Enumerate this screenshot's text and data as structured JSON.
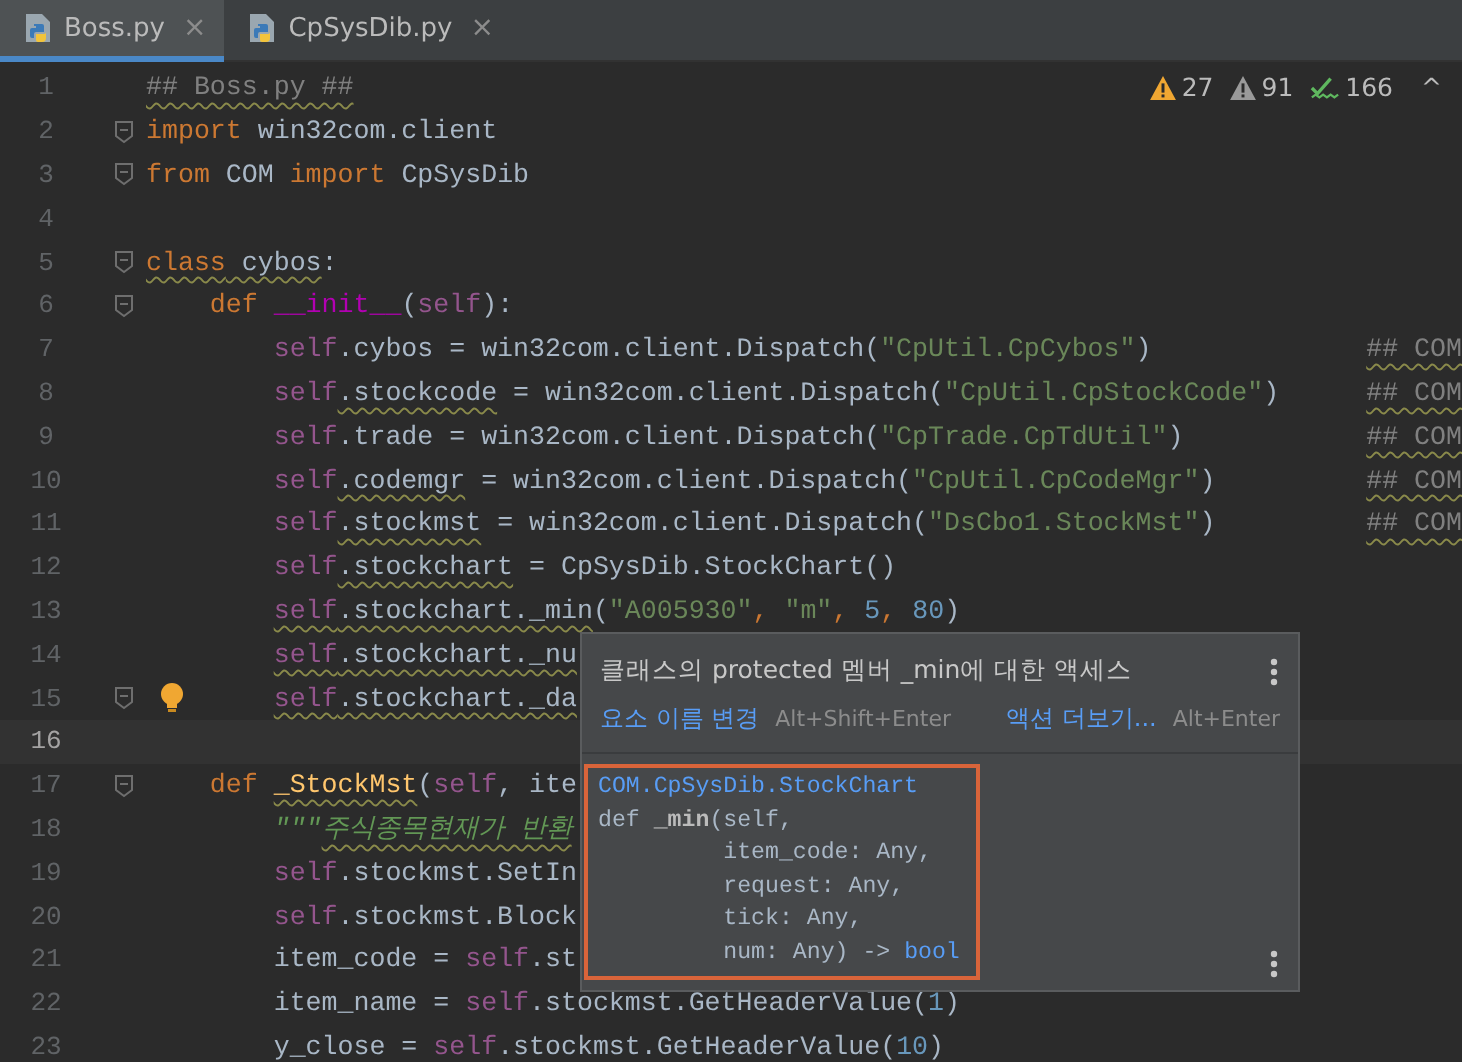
{
  "tabs": [
    {
      "label": "Boss.py",
      "selected": true,
      "close": "×"
    },
    {
      "label": "CpSysDib.py",
      "selected": false,
      "close": "×"
    }
  ],
  "inspections": [
    {
      "kind": "warning",
      "count": "27"
    },
    {
      "kind": "weak-warning",
      "count": "91"
    },
    {
      "kind": "typo",
      "count": "166"
    }
  ],
  "inspections_nav": "^",
  "lines": [
    {
      "number": "1",
      "current": false,
      "fold": false,
      "bulb": false,
      "tokens": [
        {
          "t": "## Boss.py ##",
          "kind": "cmt",
          "wavy": true
        }
      ]
    },
    {
      "number": "2",
      "current": false,
      "fold": true,
      "bulb": false,
      "tokens": [
        {
          "t": "import",
          "kind": "kw"
        },
        {
          "t": " win32com.client",
          "kind": "plain"
        }
      ]
    },
    {
      "number": "3",
      "current": false,
      "fold": true,
      "bulb": false,
      "tokens": [
        {
          "t": "from",
          "kind": "kw"
        },
        {
          "t": " COM ",
          "kind": "plain"
        },
        {
          "t": "import",
          "kind": "kw"
        },
        {
          "t": " CpSysDib",
          "kind": "plain"
        }
      ]
    },
    {
      "number": "4",
      "current": false,
      "fold": false,
      "bulb": false
    },
    {
      "number": "5",
      "current": false,
      "fold": true,
      "bulb": false,
      "tokens": [
        {
          "t": "class",
          "kind": "kw",
          "wavy": true
        },
        {
          "t": " cybos",
          "kind": "plain",
          "wavy": true
        },
        {
          "t": ":",
          "kind": "plain"
        }
      ]
    },
    {
      "number": "6",
      "current": false,
      "fold": true,
      "bulb": false,
      "tokens": [
        {
          "t": "    def ",
          "kind": "kw"
        },
        {
          "t": "__init__",
          "kind": "magic"
        },
        {
          "t": "(",
          "kind": "plain"
        },
        {
          "t": "self",
          "kind": "self"
        },
        {
          "t": "):",
          "kind": "plain"
        }
      ]
    },
    {
      "number": "7",
      "current": false,
      "fold": false,
      "bulb": false,
      "tokens": [
        {
          "t": "        self",
          "kind": "self"
        },
        {
          "t": ".cybos = win32com.client.Dispatch(",
          "kind": "plain"
        },
        {
          "t": "\"CpUtil.CpCybos\"",
          "kind": "str"
        },
        {
          "t": ")",
          "kind": "plain"
        }
      ],
      "comment": "## COM"
    },
    {
      "number": "8",
      "current": false,
      "fold": false,
      "bulb": false,
      "tokens": [
        {
          "t": "        self",
          "kind": "self"
        },
        {
          "t": ".stockcode",
          "kind": "plain",
          "wavy": true
        },
        {
          "t": " = win32com.client.Dispatch(",
          "kind": "plain"
        },
        {
          "t": "\"CpUtil.CpStockCode\"",
          "kind": "str"
        },
        {
          "t": ")",
          "kind": "plain"
        }
      ],
      "comment": "## COM"
    },
    {
      "number": "9",
      "current": false,
      "fold": false,
      "bulb": false,
      "tokens": [
        {
          "t": "        self",
          "kind": "self"
        },
        {
          "t": ".trade = win32com.client.Dispatch(",
          "kind": "plain"
        },
        {
          "t": "\"CpTrade.CpTdUtil\"",
          "kind": "str"
        },
        {
          "t": ")",
          "kind": "plain"
        }
      ],
      "comment": "## COM"
    },
    {
      "number": "10",
      "current": false,
      "fold": false,
      "bulb": false,
      "tokens": [
        {
          "t": "        self",
          "kind": "self"
        },
        {
          "t": ".codemgr",
          "kind": "plain",
          "wavy": true
        },
        {
          "t": " = win32com.client.Dispatch(",
          "kind": "plain"
        },
        {
          "t": "\"CpUtil.CpCodeMgr\"",
          "kind": "str"
        },
        {
          "t": ")",
          "kind": "plain"
        }
      ],
      "comment": "## COM"
    },
    {
      "number": "11",
      "current": false,
      "fold": false,
      "bulb": false,
      "tokens": [
        {
          "t": "        self",
          "kind": "self"
        },
        {
          "t": ".stockmst",
          "kind": "plain",
          "wavy": true
        },
        {
          "t": " = win32com.client.Dispatch(",
          "kind": "plain"
        },
        {
          "t": "\"DsCbo1.StockMst\"",
          "kind": "str"
        },
        {
          "t": ")",
          "kind": "plain"
        }
      ],
      "comment": "## COM"
    },
    {
      "number": "12",
      "current": false,
      "fold": false,
      "bulb": false,
      "tokens": [
        {
          "t": "        self",
          "kind": "self"
        },
        {
          "t": ".stockchart",
          "kind": "plain",
          "wavy": true
        },
        {
          "t": " = CpSysDib.StockChart()",
          "kind": "plain"
        }
      ]
    },
    {
      "number": "13",
      "current": false,
      "fold": false,
      "bulb": false,
      "tokens": [
        {
          "t": "        self",
          "kind": "self",
          "wavy": true
        },
        {
          "t": ".stockchart._min",
          "kind": "plain",
          "wavy": true
        },
        {
          "t": "(",
          "kind": "plain"
        },
        {
          "t": "\"A005930\"",
          "kind": "str"
        },
        {
          "t": ", ",
          "kind": "kw"
        },
        {
          "t": "\"m\"",
          "kind": "str"
        },
        {
          "t": ", ",
          "kind": "kw"
        },
        {
          "t": "5",
          "kind": "num"
        },
        {
          "t": ", ",
          "kind": "kw"
        },
        {
          "t": "80",
          "kind": "num"
        },
        {
          "t": ")",
          "kind": "plain"
        }
      ]
    },
    {
      "number": "14",
      "current": false,
      "fold": false,
      "bulb": false,
      "tokens": [
        {
          "t": "        self",
          "kind": "self",
          "wavy": true
        },
        {
          "t": ".stockchart._nu",
          "kind": "plain",
          "wavy": true
        }
      ]
    },
    {
      "number": "15",
      "current": false,
      "fold": true,
      "bulb": true,
      "tokens": [
        {
          "t": "        self",
          "kind": "self",
          "wavy": true
        },
        {
          "t": ".stockchart._da",
          "kind": "plain",
          "wavy": true
        }
      ]
    },
    {
      "number": "16",
      "current": true,
      "fold": false,
      "bulb": false
    },
    {
      "number": "17",
      "current": false,
      "fold": true,
      "bulb": false,
      "tokens": [
        {
          "t": "    def ",
          "kind": "kw"
        },
        {
          "t": "_StockMst",
          "kind": "fn",
          "wavy": true
        },
        {
          "t": "(",
          "kind": "plain"
        },
        {
          "t": "self",
          "kind": "self"
        },
        {
          "t": ", ite",
          "kind": "plain"
        }
      ]
    },
    {
      "number": "18",
      "current": false,
      "fold": false,
      "bulb": false,
      "tokens": [
        {
          "t": "        \"\"\"",
          "kind": "doc"
        },
        {
          "t": "주식종목현재가 반환",
          "kind": "doc",
          "wavy": true
        }
      ]
    },
    {
      "number": "19",
      "current": false,
      "fold": false,
      "bulb": false,
      "tokens": [
        {
          "t": "        self",
          "kind": "self"
        },
        {
          "t": ".stockmst.SetIn",
          "kind": "plain"
        }
      ]
    },
    {
      "number": "20",
      "current": false,
      "fold": false,
      "bulb": false,
      "tokens": [
        {
          "t": "        self",
          "kind": "self"
        },
        {
          "t": ".stockmst.Block",
          "kind": "plain"
        }
      ]
    },
    {
      "number": "21",
      "current": false,
      "fold": false,
      "bulb": false,
      "tokens": [
        {
          "t": "        item_code = ",
          "kind": "plain"
        },
        {
          "t": "self",
          "kind": "self"
        },
        {
          "t": ".st",
          "kind": "plain"
        }
      ]
    },
    {
      "number": "22",
      "current": false,
      "fold": false,
      "bulb": false,
      "tokens": [
        {
          "t": "        item_name = ",
          "kind": "plain"
        },
        {
          "t": "self",
          "kind": "self"
        },
        {
          "t": ".stockmst.GetHeaderValue(",
          "kind": "plain"
        },
        {
          "t": "1",
          "kind": "num"
        },
        {
          "t": ")",
          "kind": "plain"
        }
      ]
    },
    {
      "number": "23",
      "current": false,
      "fold": false,
      "bulb": false,
      "tokens": [
        {
          "t": "        y_close = ",
          "kind": "plain"
        },
        {
          "t": "self",
          "kind": "self"
        },
        {
          "t": ".stockmst.GetHeaderValue(",
          "kind": "plain"
        },
        {
          "t": "10",
          "kind": "num"
        },
        {
          "t": ")",
          "kind": "plain"
        }
      ]
    }
  ],
  "popup": {
    "title": "클래스의 protected 멤버 _min에 대한 액세스",
    "actions": [
      {
        "label": "요소 이름 변경",
        "shortcut": "Alt+Shift+Enter"
      },
      {
        "label": "액션 더보기...",
        "shortcut": "Alt+Enter"
      }
    ],
    "doc": [
      [
        {
          "t": "COM.CpSysDib.StockChart",
          "kind": "link"
        }
      ],
      [
        {
          "t": "def ",
          "kind": "plain"
        },
        {
          "t": "_min",
          "kind": "bold"
        },
        {
          "t": "(self,",
          "kind": "plain"
        }
      ],
      [
        {
          "t": "         item_code: Any,",
          "kind": "plain"
        }
      ],
      [
        {
          "t": "         request: Any,",
          "kind": "plain"
        }
      ],
      [
        {
          "t": "         tick: Any,",
          "kind": "plain"
        }
      ],
      [
        {
          "t": "         num: Any) -> ",
          "kind": "plain"
        },
        {
          "t": "bool",
          "kind": "link"
        }
      ]
    ]
  }
}
